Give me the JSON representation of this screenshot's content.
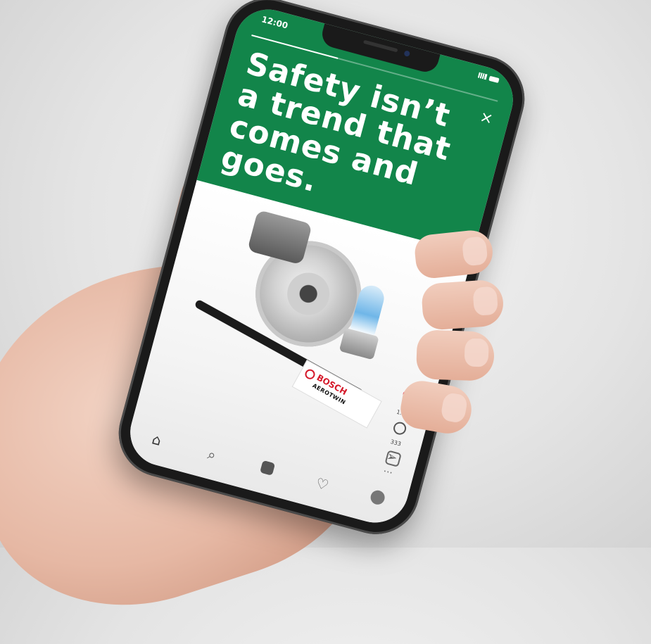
{
  "status_bar": {
    "time": "12:00"
  },
  "story": {
    "headline": "Safety isn’t a trend that comes and goes.",
    "progress_percent": 35,
    "close_label": "×"
  },
  "product": {
    "pack_brand": "BOSCH",
    "pack_product": "AEROTWIN"
  },
  "actions": {
    "likes": "1.2m",
    "comments": "333"
  },
  "colors": {
    "brand_green": "#12854a",
    "like_red": "#e0263b"
  },
  "icons": [
    "heart-icon",
    "comment-icon",
    "send-icon",
    "more-icon",
    "home-icon",
    "search-icon",
    "reels-icon",
    "activity-icon",
    "profile-icon",
    "close-icon"
  ]
}
